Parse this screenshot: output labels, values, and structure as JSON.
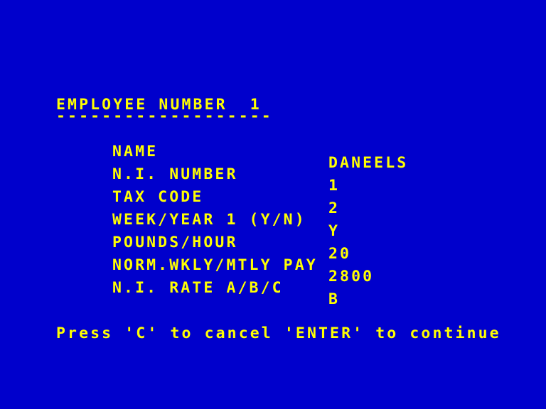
{
  "screen": {
    "background_color": "#0000cc",
    "text_color": "#ffff00",
    "title": "EMPLOYEE NUMBER  1",
    "title_rule": "-------------------",
    "fields": [
      {
        "label": "NAME",
        "value": "DANEELS"
      },
      {
        "label": "N.I. NUMBER",
        "value": "1"
      },
      {
        "label": "TAX CODE",
        "value": "2"
      },
      {
        "label": "WEEK/YEAR 1 (Y/N)",
        "value": "Y"
      },
      {
        "label": "POUNDS/HOUR",
        "value": "20"
      },
      {
        "label": "NORM.WKLY/MTLY PAY",
        "value": "2800"
      },
      {
        "label": "N.I. RATE A/B/C",
        "value": "B"
      }
    ],
    "prompt": "Press 'C' to cancel 'ENTER' to continue"
  }
}
